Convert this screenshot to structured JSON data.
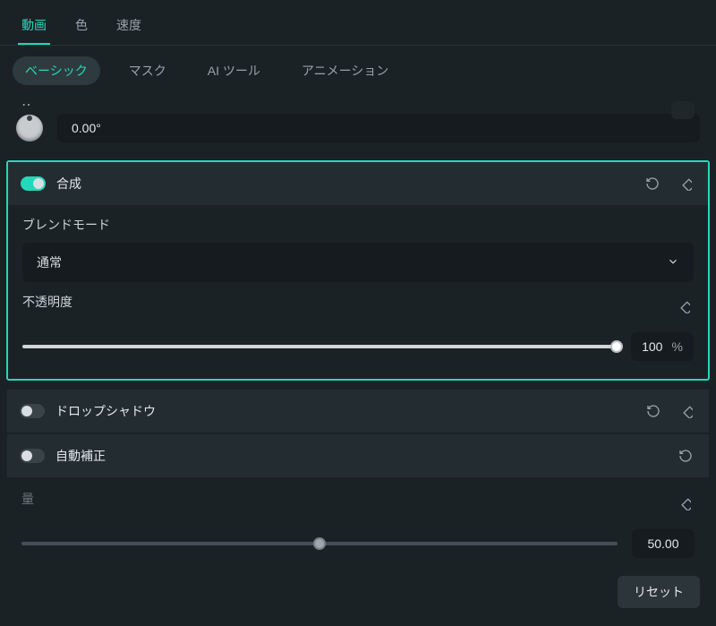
{
  "topTabs": {
    "video": "動画",
    "color": "色",
    "speed": "速度"
  },
  "subTabs": {
    "basic": "ベーシック",
    "mask": "マスク",
    "aiTools": "AI ツール",
    "animation": "アニメーション"
  },
  "rotation": {
    "value": "0.00°"
  },
  "composite": {
    "title": "合成",
    "enabled": true,
    "blendMode": {
      "label": "ブレンドモード",
      "value": "通常"
    },
    "opacity": {
      "label": "不透明度",
      "value": "100",
      "unit": "%",
      "percent": 100
    }
  },
  "dropShadow": {
    "title": "ドロップシャドウ",
    "enabled": false
  },
  "autoCorrect": {
    "title": "自動補正",
    "enabled": false
  },
  "amount": {
    "label": "量",
    "value": "50.00",
    "percent": 50
  },
  "footer": {
    "reset": "リセット"
  }
}
